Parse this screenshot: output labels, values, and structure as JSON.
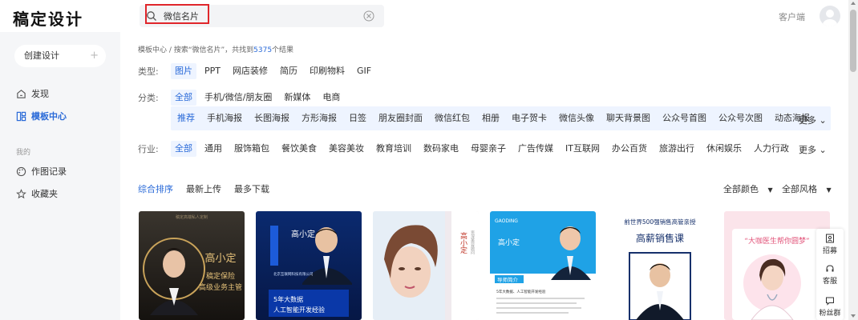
{
  "app": {
    "logo": "稿定设计"
  },
  "search": {
    "value": "微信名片",
    "placeholder": ""
  },
  "header": {
    "client_link": "客户端"
  },
  "sidebar": {
    "create_label": "创建设计",
    "items": [
      {
        "label": "发现",
        "icon": "home-icon"
      },
      {
        "label": "模板中心",
        "icon": "grid-icon",
        "active": true
      }
    ],
    "section_title": "我的",
    "my_items": [
      {
        "label": "作图记录",
        "icon": "palette-icon"
      },
      {
        "label": "收藏夹",
        "icon": "star-icon"
      }
    ]
  },
  "breadcrumb": {
    "root": "模板中心",
    "sep": "/",
    "prefix": "搜索“微信名片”，共找到",
    "count": "5375",
    "suffix": "个结果"
  },
  "type_filter": {
    "label": "类型:",
    "options": [
      "图片",
      "PPT",
      "网店装修",
      "简历",
      "印刷物料",
      "GIF"
    ],
    "selected": "图片"
  },
  "category_filter": {
    "label": "分类:",
    "options": [
      "全部",
      "手机/微信/朋友圈",
      "新媒体",
      "电商"
    ],
    "selected": "全部",
    "sub_options": [
      "推荐",
      "手机海报",
      "长图海报",
      "方形海报",
      "日签",
      "朋友圈封面",
      "微信红包",
      "相册",
      "电子贺卡",
      "微信头像",
      "聊天背景图",
      "公众号首图",
      "公众号次图",
      "动态海报"
    ],
    "sub_selected": "推荐",
    "more": "更多"
  },
  "industry_filter": {
    "label": "行业:",
    "options": [
      "全部",
      "通用",
      "服饰箱包",
      "餐饮美食",
      "美容美妆",
      "教育培训",
      "数码家电",
      "母婴亲子",
      "广告传媒",
      "IT互联网",
      "办公百货",
      "旅游出行",
      "休闲娱乐",
      "人力行政"
    ],
    "selected": "全部",
    "more": "更多"
  },
  "sort": {
    "options": [
      "综合排序",
      "最新上传",
      "最多下载"
    ],
    "selected": "综合排序",
    "color_filter": "全部颜色",
    "style_filter": "全部风格"
  },
  "cards": [
    {
      "name": "高小定",
      "line1": "稿定保险",
      "line2": "高级业务主管",
      "top": "稿定高端私人定制"
    },
    {
      "name": "高小定",
      "sub": "北京互联网科技有限公司",
      "bottom1": "5年大数据",
      "bottom2": "人工智能开发经验"
    },
    {
      "name": "高小定",
      "sub": "资深美容顾问"
    },
    {
      "name": "高小定",
      "sub": "GAODING",
      "section": "导师简介",
      "bullet": "5年大数据、人工智能开发经验"
    },
    {
      "headline": "前世界500强销售高管亲授",
      "title": "高薪销售课"
    },
    {
      "quote": "“大咖医生帮你圆梦”"
    }
  ],
  "float_tools": [
    {
      "label": "招募",
      "icon": "recruit-icon"
    },
    {
      "label": "客服",
      "icon": "headset-icon"
    },
    {
      "label": "粉丝群",
      "icon": "chat-icon"
    }
  ],
  "colors": {
    "accent": "#2a6ad8",
    "highlight": "#e0262b"
  }
}
